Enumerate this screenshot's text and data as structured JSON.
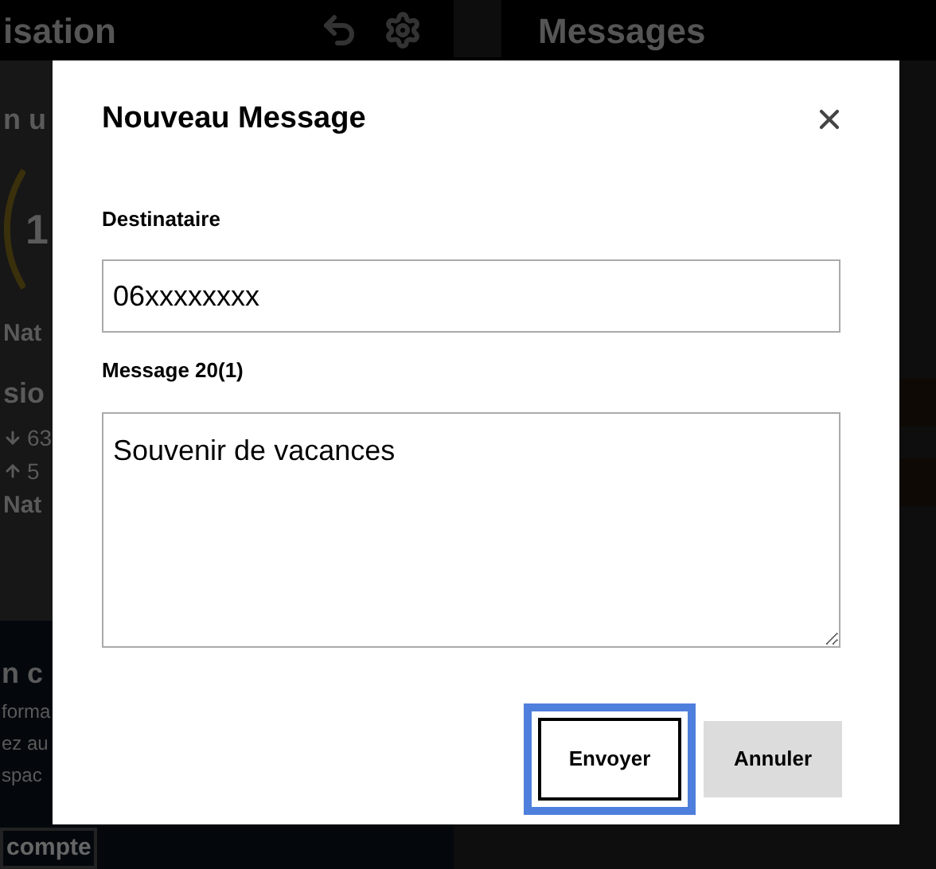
{
  "background": {
    "left_header": {
      "title": "isation"
    },
    "right_header": {
      "title": "Messages"
    },
    "usage": {
      "heading": "n u",
      "value": "1",
      "plan": "Nat"
    },
    "session": {
      "heading": "sio",
      "download": "63",
      "upload": "5",
      "plan": "Nat"
    },
    "info": {
      "heading": "n c",
      "lines": [
        "forma",
        "ez au",
        "spac"
      ]
    },
    "bottom": {
      "button": "compte"
    }
  },
  "dialog": {
    "title": "Nouveau Message",
    "recipient_label": "Destinataire",
    "recipient_value": "06xxxxxxxx",
    "message_label": "Message 20(1)",
    "message_value": "Souvenir de vacances",
    "buttons": [
      {
        "label": "Envoyer",
        "kind": "primary",
        "focused": true
      },
      {
        "label": "Annuler",
        "kind": "secondary",
        "focused": false
      }
    ]
  }
}
